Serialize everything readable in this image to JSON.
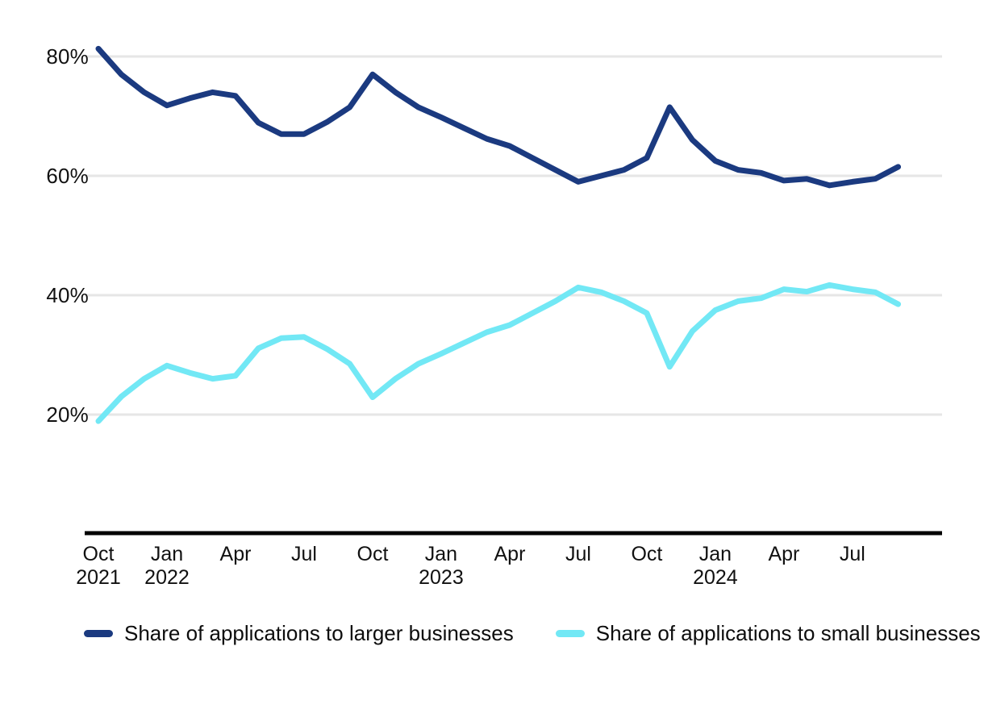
{
  "chart_data": {
    "type": "line",
    "title": "",
    "subtitle": "",
    "xlabel": "",
    "ylabel": "",
    "ylim": [
      0,
      88
    ],
    "y_ticks": [
      20,
      40,
      60,
      80
    ],
    "y_tick_labels": [
      "20%",
      "40%",
      "60%",
      "80%"
    ],
    "grid": "horizontal",
    "legend_position": "bottom-left",
    "x": [
      "Oct 2021",
      "Nov 2021",
      "Dec 2021",
      "Jan 2022",
      "Feb 2022",
      "Mar 2022",
      "Apr 2022",
      "May 2022",
      "Jun 2022",
      "Jul 2022",
      "Aug 2022",
      "Sep 2022",
      "Oct 2022",
      "Nov 2022",
      "Dec 2022",
      "Jan 2023",
      "Feb 2023",
      "Mar 2023",
      "Apr 2023",
      "May 2023",
      "Jun 2023",
      "Jul 2023",
      "Aug 2023",
      "Sep 2023",
      "Oct 2023",
      "Nov 2023",
      "Dec 2023",
      "Jan 2024",
      "Feb 2024",
      "Mar 2024",
      "Apr 2024",
      "May 2024",
      "Jun 2024",
      "Jul 2024",
      "Aug 2024",
      "Sep 2024"
    ],
    "x_tick_positions": [
      "Oct 2021",
      "Jan 2022",
      "Apr 2022",
      "Jul 2022",
      "Oct 2022",
      "Jan 2023",
      "Apr 2023",
      "Jul 2023",
      "Oct 2023",
      "Jan 2024",
      "Apr 2024",
      "Jul 2024"
    ],
    "x_tick_labels": [
      {
        "month": "Oct",
        "year": "2021"
      },
      {
        "month": "Jan",
        "year": "2022"
      },
      {
        "month": "Apr",
        "year": ""
      },
      {
        "month": "Jul",
        "year": ""
      },
      {
        "month": "Oct",
        "year": ""
      },
      {
        "month": "Jan",
        "year": "2023"
      },
      {
        "month": "Apr",
        "year": ""
      },
      {
        "month": "Jul",
        "year": ""
      },
      {
        "month": "Oct",
        "year": ""
      },
      {
        "month": "Jan",
        "year": "2024"
      },
      {
        "month": "Apr",
        "year": ""
      },
      {
        "month": "Jul",
        "year": ""
      }
    ],
    "series": [
      {
        "name": "Share of applications to larger businesses",
        "color": "#1b3a80",
        "values": [
          81.3,
          77.0,
          74.0,
          71.8,
          73.0,
          74.0,
          73.4,
          68.9,
          67.0,
          67.0,
          69.0,
          71.5,
          77.0,
          74.0,
          71.5,
          69.8,
          68.0,
          66.2,
          65.0,
          63.0,
          61.0,
          59.0,
          60.0,
          61.0,
          63.0,
          71.5,
          66.0,
          62.5,
          61.0,
          60.5,
          59.2,
          59.5,
          58.4,
          59.0,
          59.5,
          61.5
        ]
      },
      {
        "name": "Share of applications to small businesses",
        "color": "#72e8f5",
        "values": [
          18.9,
          23.0,
          26.0,
          28.2,
          27.0,
          26.0,
          26.5,
          31.1,
          32.8,
          33.0,
          31.0,
          28.5,
          22.9,
          26.0,
          28.5,
          30.2,
          32.0,
          33.8,
          35.0,
          37.0,
          39.0,
          41.3,
          40.5,
          39.0,
          37.0,
          28.0,
          34.0,
          37.5,
          39.0,
          39.5,
          41.0,
          40.6,
          41.7,
          41.0,
          40.5,
          38.5
        ]
      }
    ],
    "series_end_points": [
      {
        "name": "Share of applications to larger businesses",
        "value": 68.0
      },
      {
        "name": "Share of applications to small businesses",
        "value": 31.6
      }
    ],
    "notes": "Monthly series; the two shares are complementary and sum to roughly 100%."
  },
  "legend": {
    "items": [
      {
        "label": "Share of applications to larger businesses",
        "color": "#1b3a80"
      },
      {
        "label": "Share of applications to small businesses",
        "color": "#72e8f5"
      }
    ]
  },
  "axis": {
    "axis_line_color": "#000000",
    "gridline_color": "#e6e6e6"
  }
}
